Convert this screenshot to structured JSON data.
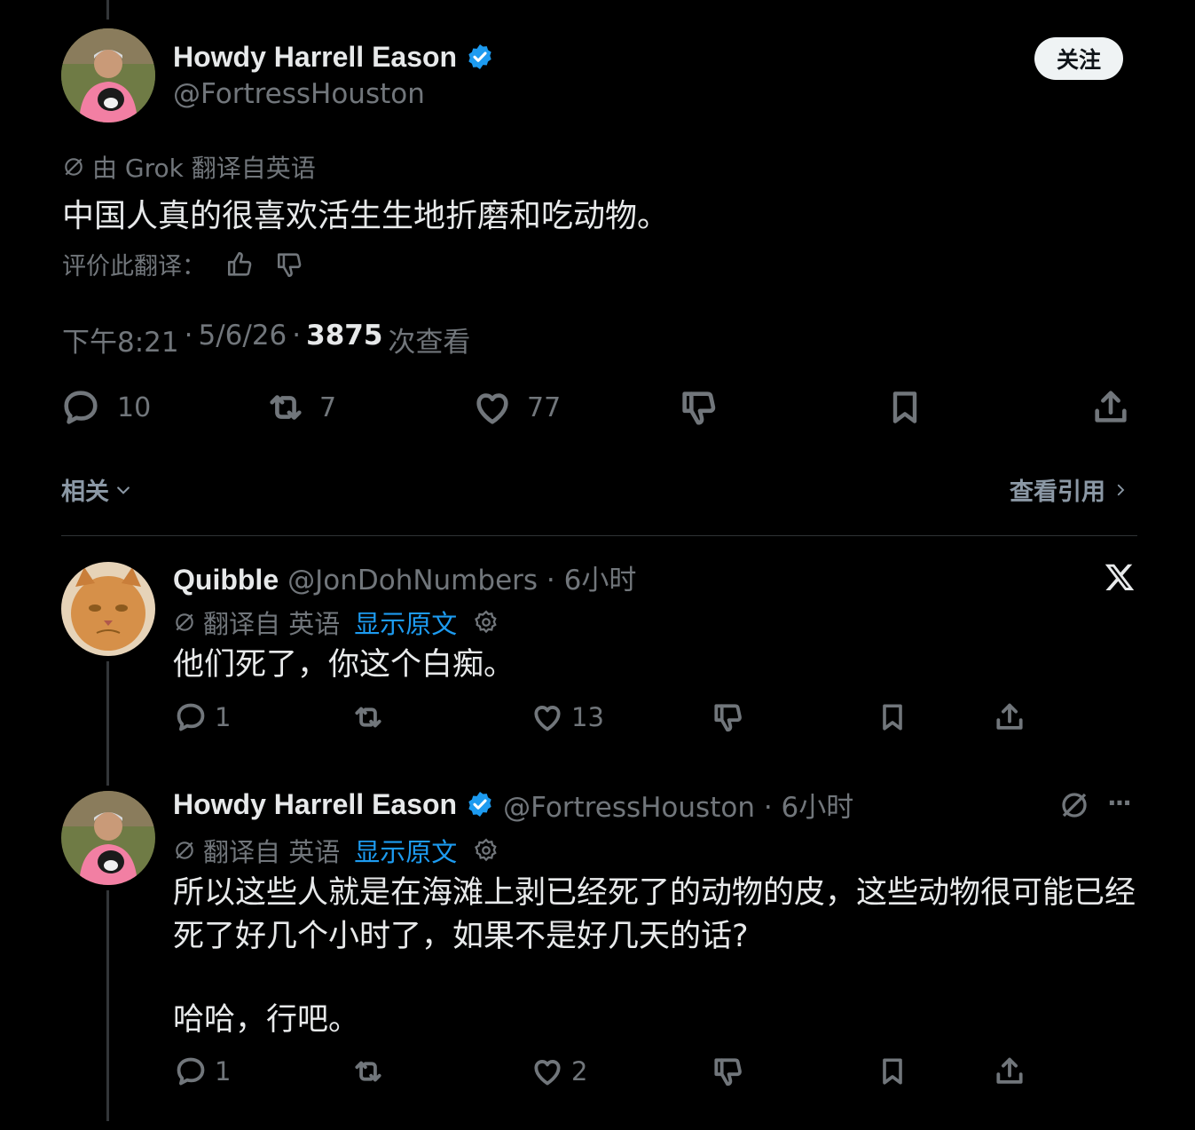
{
  "main_tweet": {
    "author_name": "Howdy Harrell Eason",
    "handle": "@FortressHouston",
    "follow_label": "关注",
    "translated_by": "由 Grok 翻译自英语",
    "text": "中国人真的很喜欢活生生地折磨和吃动物。",
    "rate_translation_label": "评价此翻译：",
    "time": "下午8:21",
    "date": "5/6/26",
    "separator": "·",
    "views_count": "3875",
    "views_label": "次查看",
    "replies": "10",
    "retweets": "7",
    "likes": "77"
  },
  "filter_bar": {
    "related_label": "相关",
    "view_quotes_label": "查看引用"
  },
  "reply1": {
    "author_name": "Quibble",
    "handle_time": "@JonDohNumbers · 6小时",
    "translated_label": "翻译自 英语",
    "show_original": "显示原文",
    "text": "他们死了，你这个白痴。",
    "replies": "1",
    "retweets": "",
    "likes": "13"
  },
  "reply2": {
    "author_name": "Howdy Harrell Eason",
    "handle_time": "@FortressHouston · 6小时",
    "translated_label": "翻译自 英语",
    "show_original": "显示原文",
    "text_line1": "所以这些人就是在海滩上剥已经死了的动物的皮，这些动物很可能已经",
    "text_line2": "死了好几个小时了，如果不是好几天的话?",
    "text_line3": "哈哈，行吧。",
    "more_label": "···",
    "replies": "1",
    "retweets": "",
    "likes": "2"
  },
  "colors": {
    "background": "#000000",
    "text": "#e7e9ea",
    "muted": "#71767b",
    "accent": "#1d9bf0",
    "verified": "#1d9bf0"
  },
  "icons": [
    "translate-icon",
    "thumbs-up-icon",
    "thumbs-down-icon",
    "reply-icon",
    "retweet-icon",
    "like-icon",
    "dislike-icon",
    "bookmark-icon",
    "share-icon",
    "x-logo-icon",
    "settings-icon",
    "chevron-down-icon",
    "chevron-right-icon",
    "verified-badge-icon",
    "more-icon"
  ]
}
